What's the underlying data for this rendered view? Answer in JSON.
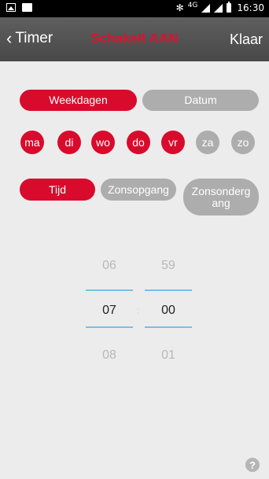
{
  "status_bar": {
    "network": "4G",
    "time": "16:30"
  },
  "header": {
    "back_label": "Timer",
    "title": "Schakelt AAN",
    "done_label": "Klaar",
    "title_color": "#e0102e"
  },
  "mode_tabs": {
    "weekdays": "Weekdagen",
    "date": "Datum",
    "selected": "Weekdagen"
  },
  "days": [
    {
      "label": "ma",
      "selected": true
    },
    {
      "label": "di",
      "selected": true
    },
    {
      "label": "wo",
      "selected": true
    },
    {
      "label": "do",
      "selected": true
    },
    {
      "label": "vr",
      "selected": true
    },
    {
      "label": "za",
      "selected": false
    },
    {
      "label": "zo",
      "selected": false
    }
  ],
  "trigger_tabs": {
    "time": "Tijd",
    "sunrise": "Zonsopgang",
    "sunset_line1": "Zonsonderg",
    "sunset_line2": "ang",
    "selected": "Tijd"
  },
  "time_picker": {
    "hours": {
      "prev": "06",
      "current": "07",
      "next": "08"
    },
    "minutes": {
      "prev": "59",
      "current": "00",
      "next": "01"
    },
    "separator": ":"
  },
  "help": {
    "label": "?"
  },
  "colors": {
    "active": "#d80b2c",
    "inactive": "#adadad",
    "picker_line": "#79bfe6"
  }
}
